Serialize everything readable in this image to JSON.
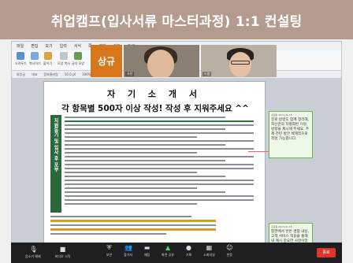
{
  "banner": {
    "title": "취업캠프(입사서류 마스터과정) 1:1 컨설팅"
  },
  "menu": {
    "items": [
      "파일",
      "편집",
      "보기",
      "입력",
      "서식",
      "쪽",
      "보안",
      "검토",
      "도구"
    ]
  },
  "ribbon": {
    "groups": [
      "오려두기",
      "복사하기",
      "붙이기",
      "모양 복사",
      "글자 모양",
      "문단 모양"
    ],
    "right": [
      "글 배치",
      "그룹화",
      "회전",
      "정렬"
    ]
  },
  "toolbar2": {
    "items": [
      "바탕글",
      "대표",
      "함초롬바탕",
      "10.0 pt",
      "100%"
    ]
  },
  "video": {
    "tile1_name": "상규",
    "tile2_label": "사진",
    "tile3_label": "드림"
  },
  "document": {
    "title": "자 기 소 개 서",
    "subtitle": "각 항목별 500자 이상 작성! 작성 후 지워주세요 ^^",
    "sidebar_label": "지원동기 및 입사 후 포부"
  },
  "comments": [
    {
      "meta": "홍길동 2024-01-15",
      "text": "진로 방향도 함께 정리해, 자신만의 차별화된 이유, 방향을 제시해 주세요. 주제 관련 방안 체계적으로 작성 가능합니다."
    },
    {
      "meta": "홍길동 2024-01-15",
      "text": "합한에서 반반 경험 내용, 고객 서비스 적용을 통해 내 예시 중요한 사항이었습니다."
    }
  ],
  "statusbar": {
    "text": "1/1쪽  1단  1줄  1칸  문단 2개  변경 내용 [기록 중지]"
  },
  "zoom": {
    "left": [
      "음소거 해제",
      "비디오 시작"
    ],
    "center": [
      "보안",
      "참가자",
      "채팅",
      "화면 공유",
      "기록",
      "소회의실",
      "반응"
    ],
    "end": "종료"
  }
}
